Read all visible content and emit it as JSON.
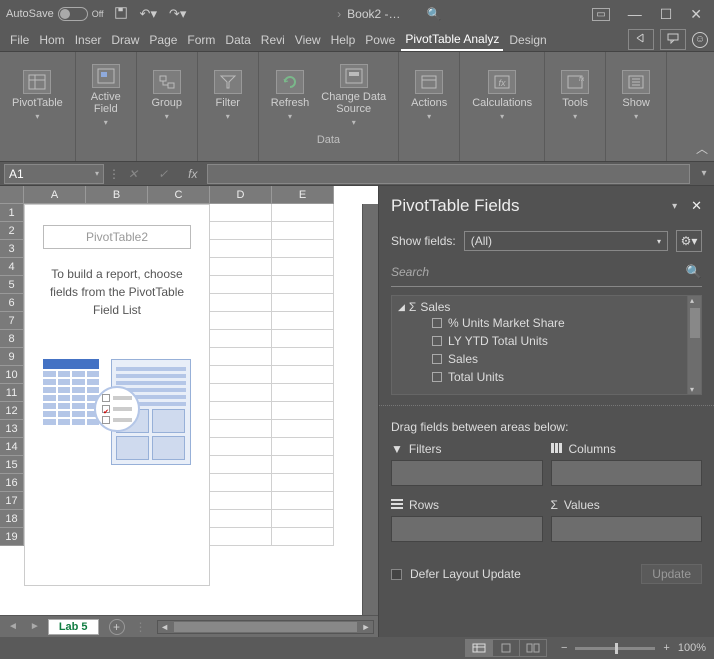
{
  "titlebar": {
    "autosave_label": "AutoSave",
    "autosave_state": "Off",
    "book_title": "Book2 -…"
  },
  "tabs": {
    "file": "File",
    "home": "Hom",
    "insert": "Inser",
    "draw": "Draw",
    "page": "Page",
    "formulas": "Form",
    "data": "Data",
    "review": "Revi",
    "view": "View",
    "help": "Help",
    "power": "Powe",
    "pivot_analyze": "PivotTable Analyz",
    "design": "Design"
  },
  "ribbon": {
    "pivottable": "PivotTable",
    "active_field": "Active\nField",
    "group": "Group",
    "filter": "Filter",
    "refresh": "Refresh",
    "change_ds": "Change Data\nSource",
    "data_group": "Data",
    "actions": "Actions",
    "calculations": "Calculations",
    "tools": "Tools",
    "show": "Show"
  },
  "formula_bar": {
    "namebox": "A1",
    "fx": "fx"
  },
  "grid": {
    "cols": [
      "A",
      "B",
      "C",
      "D",
      "E"
    ],
    "rows": [
      "1",
      "2",
      "3",
      "4",
      "5",
      "6",
      "7",
      "8",
      "9",
      "10",
      "11",
      "12",
      "13",
      "14",
      "15",
      "16",
      "17",
      "18",
      "19"
    ]
  },
  "pivot_placeholder": {
    "title": "PivotTable2",
    "msg": "To build a report, choose fields from the PivotTable Field List"
  },
  "sheet": {
    "active": "Lab 5"
  },
  "pane": {
    "title": "PivotTable Fields",
    "show_fields_label": "Show fields:",
    "show_fields_value": "(All)",
    "search_placeholder": "Search",
    "field_group": "Sales",
    "fields": [
      "% Units Market Share",
      "LY YTD Total Units",
      "Sales",
      "Total Units"
    ],
    "drag_msg": "Drag fields between areas below:",
    "area_filters": "Filters",
    "area_columns": "Columns",
    "area_rows": "Rows",
    "area_values": "Values",
    "defer_label": "Defer Layout Update",
    "update_btn": "Update"
  },
  "status": {
    "zoom": "100%"
  }
}
